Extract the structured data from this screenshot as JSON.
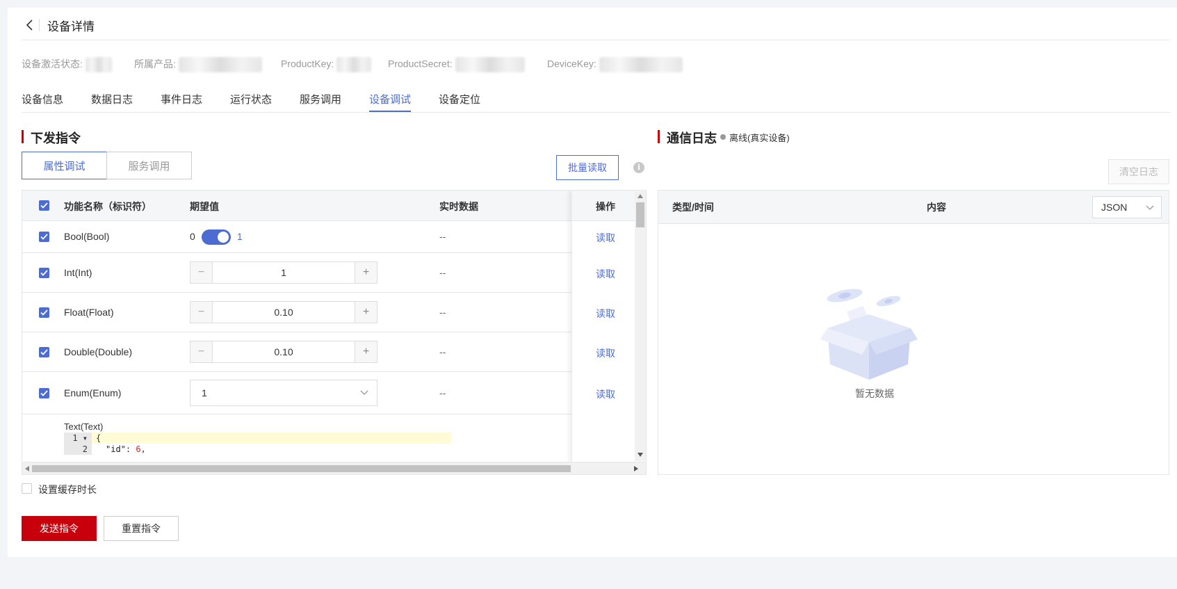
{
  "header": {
    "title": "设备详情"
  },
  "info": {
    "activation_label": "设备激活状态:",
    "product_label": "所属产品:",
    "product_key_label": "ProductKey:",
    "product_secret_label": "ProductSecret:",
    "device_key_label": "DeviceKey:"
  },
  "tabs": [
    {
      "label": "设备信息"
    },
    {
      "label": "数据日志"
    },
    {
      "label": "事件日志"
    },
    {
      "label": "运行状态"
    },
    {
      "label": "服务调用"
    },
    {
      "label": "设备调试",
      "active": true
    },
    {
      "label": "设备定位"
    }
  ],
  "command": {
    "title": "下发指令",
    "seg_property": "属性调试",
    "seg_service": "服务调用",
    "batch_read": "批量读取",
    "info_glyph": "i"
  },
  "table": {
    "headers": {
      "name": "功能名称（标识符）",
      "expected": "期望值",
      "realtime": "实时数据",
      "op": "操作"
    },
    "rows": [
      {
        "name": "Bool(Bool)",
        "off_label": "0",
        "on_label": "1",
        "realtime": "--",
        "op": "读取"
      },
      {
        "name": "Int(Int)",
        "value": "1",
        "realtime": "--",
        "op": "读取"
      },
      {
        "name": "Float(Float)",
        "value": "0.10",
        "realtime": "--",
        "op": "读取"
      },
      {
        "name": "Double(Double)",
        "value": "0.10",
        "realtime": "--",
        "op": "读取"
      },
      {
        "name": "Enum(Enum)",
        "value": "1",
        "realtime": "--",
        "op": "读取"
      }
    ],
    "text_row": {
      "name": "Text(Text)",
      "line1_no": "1",
      "line1": "{",
      "line2_no": "2",
      "line2_key": "\"id\"",
      "line2_colon": ": ",
      "line2_val": "6",
      "line2_comma": ","
    },
    "stepper_minus": "−",
    "stepper_plus": "+"
  },
  "log": {
    "title": "通信日志",
    "status": "离线(真实设备)",
    "clear": "清空日志",
    "col_type": "类型/时间",
    "col_content": "内容",
    "format": "JSON",
    "empty": "暂无数据"
  },
  "footer": {
    "cache_label": "设置缓存时长",
    "send": "发送指令",
    "reset": "重置指令"
  },
  "colors": {
    "accent": "#4d6cd1",
    "brand_red": "#c7000b",
    "json_string": "#1a1a1a",
    "json_number": "#d22"
  }
}
